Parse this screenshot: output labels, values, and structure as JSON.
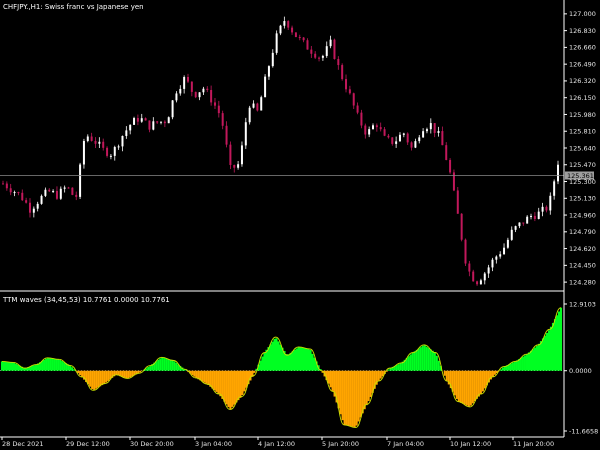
{
  "window": {
    "title": "CHFJPY.,H1:  Swiss franc vs Japanese yen"
  },
  "colors": {
    "background": "#000000",
    "axis": "#ffffff",
    "bull_candle": "#ffffff",
    "bear_candle": "#c2185b",
    "current_price_line": "#8a8a8a",
    "price_tag": "#9e9e9e",
    "histogram_positive": "#00ff22",
    "histogram_negative": "#ffa500",
    "signal_line": "#c8e000",
    "zero_line": "#c8c8c8"
  },
  "price_pane": {
    "y_ticks": [
      "127.000",
      "126.830",
      "126.660",
      "126.490",
      "126.320",
      "126.150",
      "125.980",
      "125.810",
      "125.640",
      "125.470",
      "125.300",
      "125.130",
      "124.960",
      "124.790",
      "124.620",
      "124.450",
      "124.280"
    ],
    "current_price": "125.361",
    "current_price_value": 125.361
  },
  "indicator_pane": {
    "title": "TTM waves (34,45,53) 10.7761 0.0000 10.7761",
    "y_ticks": [
      "12.9103",
      "0.0000",
      "-11.6658"
    ]
  },
  "x_axis": {
    "labels": [
      "28 Dec 2021",
      "29 Dec 12:00",
      "30 Dec 20:00",
      "3 Jan 04:00",
      "4 Jan 12:00",
      "5 Jan 20:00",
      "7 Jan 04:00",
      "10 Jan 12:00",
      "11 Jan 20:00"
    ]
  },
  "chart_data": [
    {
      "type": "candlestick",
      "title": "CHFJPY.,H1:  Swiss franc vs Japanese yen",
      "ylim": [
        124.2,
        127.1
      ],
      "x_labels": [
        "28 Dec 2021",
        "29 Dec 12:00",
        "30 Dec 20:00",
        "3 Jan 04:00",
        "4 Jan 12:00",
        "5 Jan 20:00",
        "7 Jan 04:00",
        "10 Jan 12:00",
        "11 Jan 20:00"
      ],
      "close_path": [
        125.28,
        125.22,
        125.15,
        125.02,
        125.12,
        125.2,
        125.16,
        125.25,
        125.12,
        125.78,
        125.72,
        125.62,
        125.58,
        125.75,
        125.88,
        125.95,
        125.86,
        125.9,
        125.92,
        126.22,
        126.35,
        126.18,
        126.25,
        126.12,
        125.95,
        125.42,
        125.48,
        126.1,
        126.0,
        126.4,
        126.75,
        126.95,
        126.8,
        126.7,
        126.62,
        126.55,
        126.7,
        126.42,
        126.2,
        125.95,
        125.78,
        125.9,
        125.72,
        125.7,
        125.8,
        125.62,
        125.85,
        125.88,
        125.75,
        125.45,
        124.95,
        124.42,
        124.28,
        124.38,
        124.52,
        124.62,
        124.8,
        124.88,
        124.95,
        124.98,
        125.05,
        125.5
      ]
    },
    {
      "type": "area",
      "title": "TTM waves (34,45,53) 10.7761 0.0000 10.7761",
      "ylim": [
        -11.6658,
        12.9103
      ],
      "series": [
        {
          "values": [
            1.8,
            1.6,
            0.5,
            1.2,
            2.5,
            2.2,
            1.0,
            -1.2,
            -3.8,
            -2.5,
            -0.8,
            -1.5,
            -0.5,
            1.0,
            2.6,
            2.0,
            0.3,
            -1.4,
            -2.6,
            -4.5,
            -7.5,
            -5.0,
            -1.0,
            3.5,
            6.5,
            3.0,
            4.6,
            4.2,
            0.0,
            -4.0,
            -10.5,
            -11.0,
            -6.5,
            -2.0,
            0.5,
            1.5,
            3.5,
            5.0,
            3.5,
            -2.0,
            -6.0,
            -7.0,
            -4.5,
            -1.2,
            0.8,
            1.8,
            3.2,
            5.0,
            8.0,
            12.2
          ]
        }
      ]
    }
  ]
}
